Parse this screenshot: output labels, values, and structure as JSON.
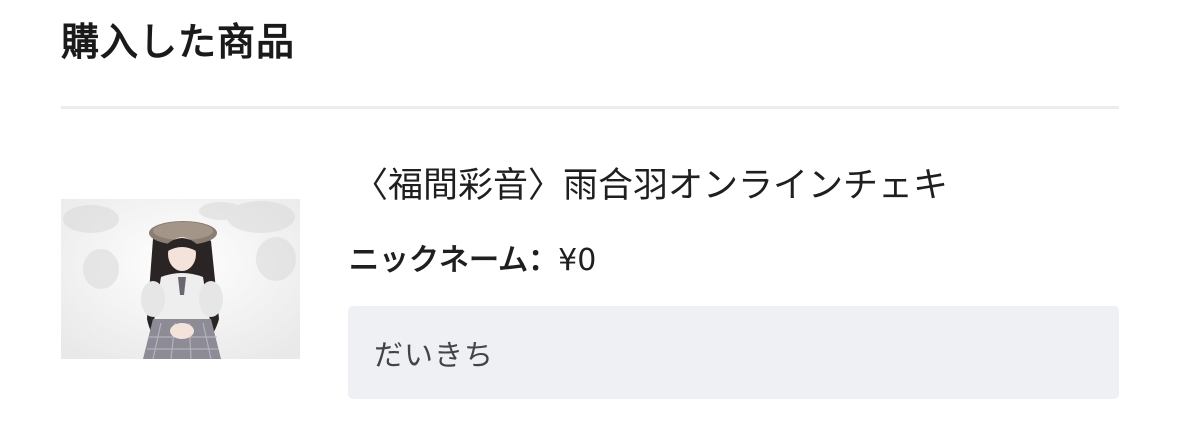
{
  "section": {
    "title": "購入した商品"
  },
  "item": {
    "image_alt": "product photo",
    "name": "〈福間彩音〉雨合羽オンラインチェキ",
    "price_label": "ニックネーム：",
    "price_value": "¥0",
    "nickname_value": "だいきち"
  }
}
